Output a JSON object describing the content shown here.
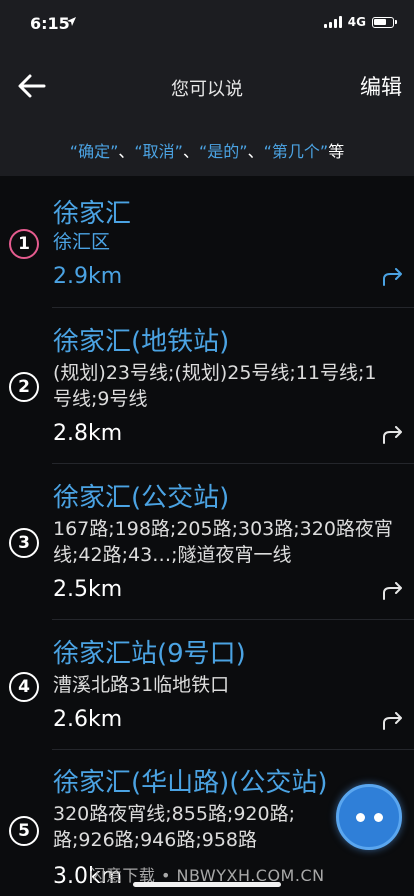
{
  "status": {
    "time": "6:15",
    "location_icon": "location-arrow-icon",
    "network": "4G",
    "signal_icon": "signal-icon",
    "battery_icon": "battery-icon"
  },
  "nav": {
    "back_icon": "back-arrow-icon",
    "title": "您可以说",
    "edit_label": "编辑"
  },
  "hint": {
    "q1": "“确定”",
    "sep1": "、",
    "q2": "“取消”",
    "sep2": "、",
    "q3": "“是的”",
    "sep3": "、",
    "q4": "“第几个”",
    "tail": "等"
  },
  "results": [
    {
      "index": "1",
      "title": "徐家汇",
      "subtitle": "徐汇区",
      "distance": "2.9km"
    },
    {
      "index": "2",
      "title": "徐家汇(地铁站)",
      "subtitle": "(规划)23号线;(规划)25号线;11号线;1号线;9号线",
      "distance": "2.8km"
    },
    {
      "index": "3",
      "title": "徐家汇(公交站)",
      "subtitle": "167路;198路;205路;303路;320路夜宵线;42路;43…;隧道夜宵一线",
      "distance": "2.5km"
    },
    {
      "index": "4",
      "title": "徐家汇站(9号口)",
      "subtitle": "漕溪北路31临地铁口",
      "distance": "2.6km"
    },
    {
      "index": "5",
      "title": "徐家汇(华山路)(公交站)",
      "subtitle": "320路夜宵线;855路;920路;路;926路;946路;958路",
      "distance": "3.0km"
    }
  ],
  "route_icon": "route-turn-icon",
  "fab_icon": "voice-assistant-icon",
  "watermark": "闪意下载 • NBWYXH.COM.CN",
  "colors": {
    "accent": "#4ba3e3",
    "background": "#0b0c0e",
    "bar": "#1c1d21",
    "first_ring": "#e55c8f"
  }
}
